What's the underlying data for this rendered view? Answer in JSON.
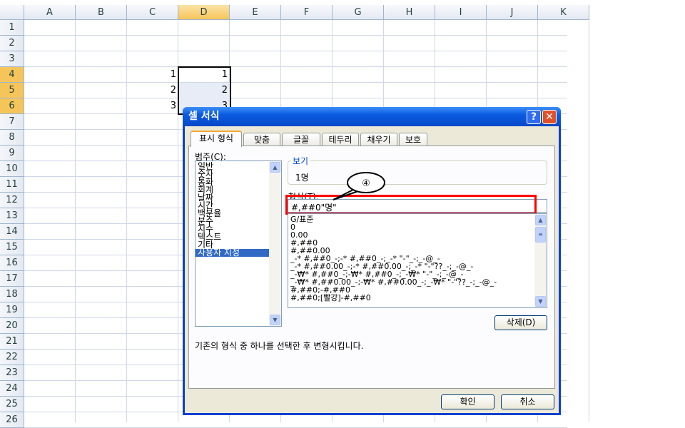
{
  "sheet": {
    "columns": [
      "A",
      "B",
      "C",
      "D",
      "E",
      "F",
      "G",
      "H",
      "I",
      "J",
      "K"
    ],
    "rows": [
      "1",
      "2",
      "3",
      "4",
      "5",
      "6",
      "7",
      "8",
      "9",
      "10",
      "11",
      "12",
      "13",
      "14",
      "15",
      "16",
      "17",
      "18",
      "19",
      "20",
      "21",
      "22",
      "23",
      "24",
      "25",
      "26"
    ],
    "cells": {
      "C4": "1",
      "C5": "2",
      "C6": "3",
      "D4": "1",
      "D5": "2",
      "D6": "3"
    }
  },
  "dialog": {
    "title": "셀 서식",
    "help": "?",
    "close": "✕",
    "tabs": [
      "표시 형식",
      "맞춤",
      "글꼴",
      "테두리",
      "채우기",
      "보호"
    ],
    "category_label": "범주(C):",
    "categories": [
      "일반",
      "숫자",
      "통화",
      "회계",
      "날짜",
      "시간",
      "백분율",
      "분수",
      "지수",
      "텍스트",
      "기타",
      "사용자 지정"
    ],
    "preview_label": "보기",
    "preview_value": "1명",
    "format_label": "형식(T):",
    "format_value": "#,##0\"명\"",
    "callout": "④",
    "formats": [
      "G/표준",
      "0",
      "0.00",
      "#,##0",
      "#,##0.00",
      "_-* #,##0_-;-* #,##0_-;_-* \"-\"_-;_-@_-",
      "_-* #,##0.00_-;-* #,##0.00_-;_-* \"-\"??_-;_-@_-",
      "_-₩* #,##0_-;-₩* #,##0_-;_-₩* \"-\"_-;_-@_-",
      "_-₩* #,##0.00_-;-₩* #,##0.00_-;_-₩* \"-\"??_-;_-@_-",
      "#,##0;-#,##0",
      "#,##0;[빨강]-#,##0"
    ],
    "delete": "삭제(D)",
    "description": "기존의 형식 중 하나를 선택한 후 변형시킵니다.",
    "ok": "확인",
    "cancel": "취소"
  },
  "colors": {
    "highlight": "#ff0000",
    "title": "#0a5be0"
  }
}
